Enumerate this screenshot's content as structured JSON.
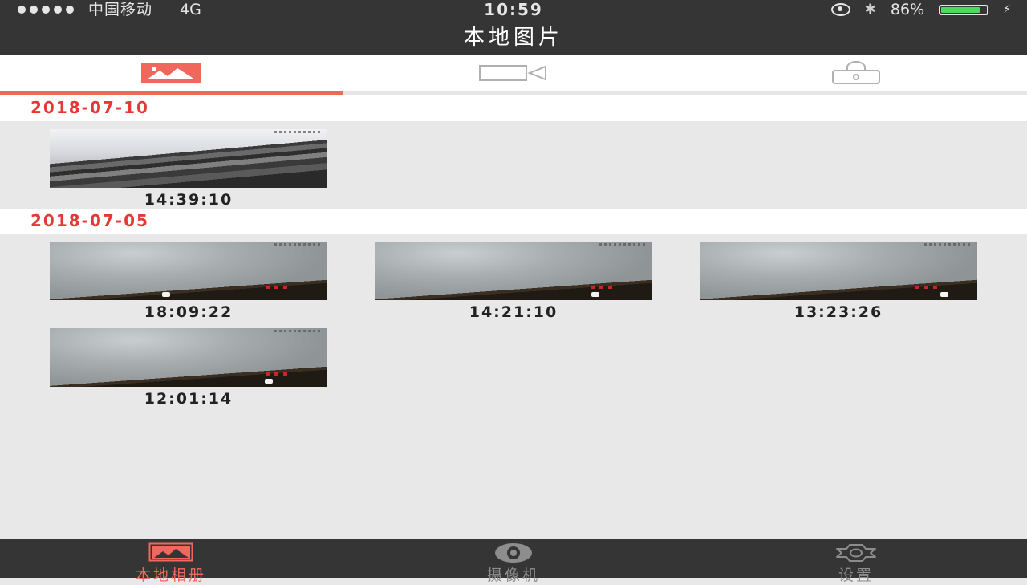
{
  "status_bar": {
    "carrier": "中国移动",
    "network": "4G",
    "time": "10:59",
    "battery_percent": "86%",
    "battery_level": 0.86
  },
  "header": {
    "title": "本地图片"
  },
  "tabs": [
    {
      "icon": "image-icon",
      "active": true
    },
    {
      "icon": "video-icon",
      "active": false
    },
    {
      "icon": "lock-icon",
      "active": false
    }
  ],
  "groups": [
    {
      "date": "2018-07-10",
      "items": [
        {
          "time": "14:39:10",
          "scene": "cables"
        }
      ]
    },
    {
      "date": "2018-07-05",
      "items": [
        {
          "time": "18:09:22",
          "scene": "ceiling"
        },
        {
          "time": "14:21:10",
          "scene": "ceiling"
        },
        {
          "time": "13:23:26",
          "scene": "ceiling"
        },
        {
          "time": "12:01:14",
          "scene": "ceiling"
        }
      ]
    }
  ],
  "bottom_nav": [
    {
      "label": "本地相册",
      "icon": "album-icon",
      "active": true
    },
    {
      "label": "摄像机",
      "icon": "camera-icon",
      "active": false
    },
    {
      "label": "设置",
      "icon": "gear-icon",
      "active": false
    }
  ],
  "colors": {
    "accent": "#f0685c",
    "date_red": "#e53935",
    "bar_dark": "#353535",
    "background": "#e8e8e8",
    "battery_green": "#4cd964"
  }
}
